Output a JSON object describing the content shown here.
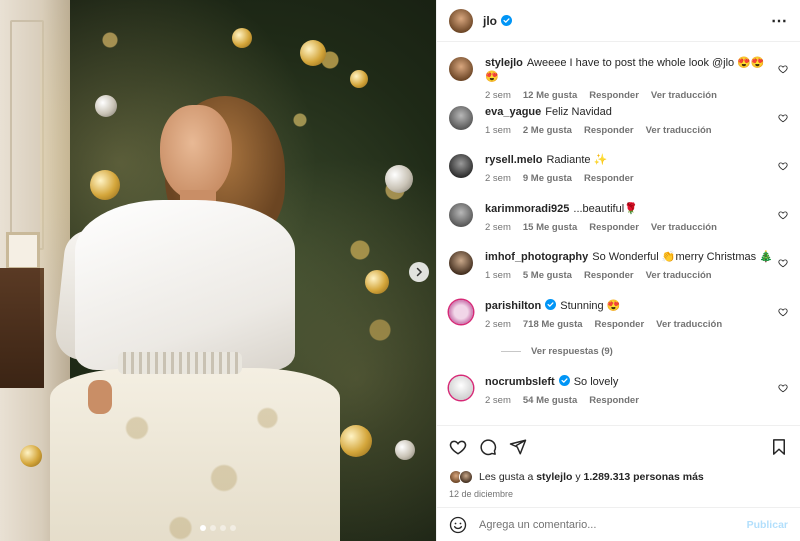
{
  "post": {
    "author": "jlo",
    "author_verified": true,
    "more_icon": "more-horizontal-icon",
    "carousel": {
      "current_slide": 1,
      "total_slides": 4
    }
  },
  "comments": [
    {
      "user": "stylejlo",
      "text": "Aweeee I have to post the whole look @jlo 😍😍😍",
      "time": "2 sem",
      "likes": "12 Me gusta",
      "reply": "Responder",
      "translate": "Ver traducción"
    },
    {
      "user": "eva_yague",
      "text": "Feliz Navidad",
      "time": "1 sem",
      "likes": "2 Me gusta",
      "reply": "Responder",
      "translate": "Ver traducción"
    },
    {
      "user": "rysell.melo",
      "text": "Radiante ✨",
      "time": "2 sem",
      "likes": "9 Me gusta",
      "reply": "Responder",
      "translate": ""
    },
    {
      "user": "karimmoradi925",
      "text": "...beautiful🌹",
      "time": "2 sem",
      "likes": "15 Me gusta",
      "reply": "Responder",
      "translate": "Ver traducción"
    },
    {
      "user": "imhof_photography",
      "text": "So Wonderful 👏merry Christmas 🎄",
      "time": "1 sem",
      "likes": "5 Me gusta",
      "reply": "Responder",
      "translate": "Ver traducción"
    },
    {
      "user": "parishilton",
      "verified": true,
      "text": "Stunning 😍",
      "time": "2 sem",
      "likes": "718 Me gusta",
      "reply": "Responder",
      "translate": "Ver traducción"
    },
    {
      "user": "nocrumbsleft",
      "verified": true,
      "text": "So lovely",
      "time": "2 sem",
      "likes": "54 Me gusta",
      "reply": "Responder",
      "translate": ""
    }
  ],
  "view_replies": "Ver respuestas (9)",
  "likes_summary": {
    "prefix": "Les gusta a",
    "user": "stylejlo",
    "connector": "y",
    "count": "1.289.313 personas más"
  },
  "date": "12 de diciembre",
  "add_comment": {
    "placeholder": "Agrega un comentario...",
    "publish_label": "Publicar"
  },
  "colors": {
    "verified": "#0095f6",
    "publish_disabled": "#b2dffc",
    "secondary_text": "#737373"
  }
}
